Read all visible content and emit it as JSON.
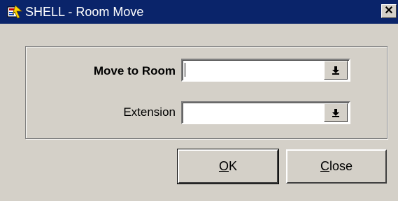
{
  "window": {
    "title": "SHELL - Room Move",
    "close_glyph": "✕"
  },
  "form": {
    "move_to_room_label": "Move to Room",
    "move_to_room_value": "",
    "extension_label": "Extension",
    "extension_value": ""
  },
  "buttons": {
    "ok_mnemonic": "O",
    "ok_rest": "K",
    "close_mnemonic": "C",
    "close_rest": "lose"
  },
  "icons": {
    "app": "app-icon",
    "dropdown": "dropdown-arrow-icon",
    "close": "close-icon"
  },
  "colors": {
    "titlebar": "#0a246a",
    "dialog_bg": "#d4d0c8"
  }
}
